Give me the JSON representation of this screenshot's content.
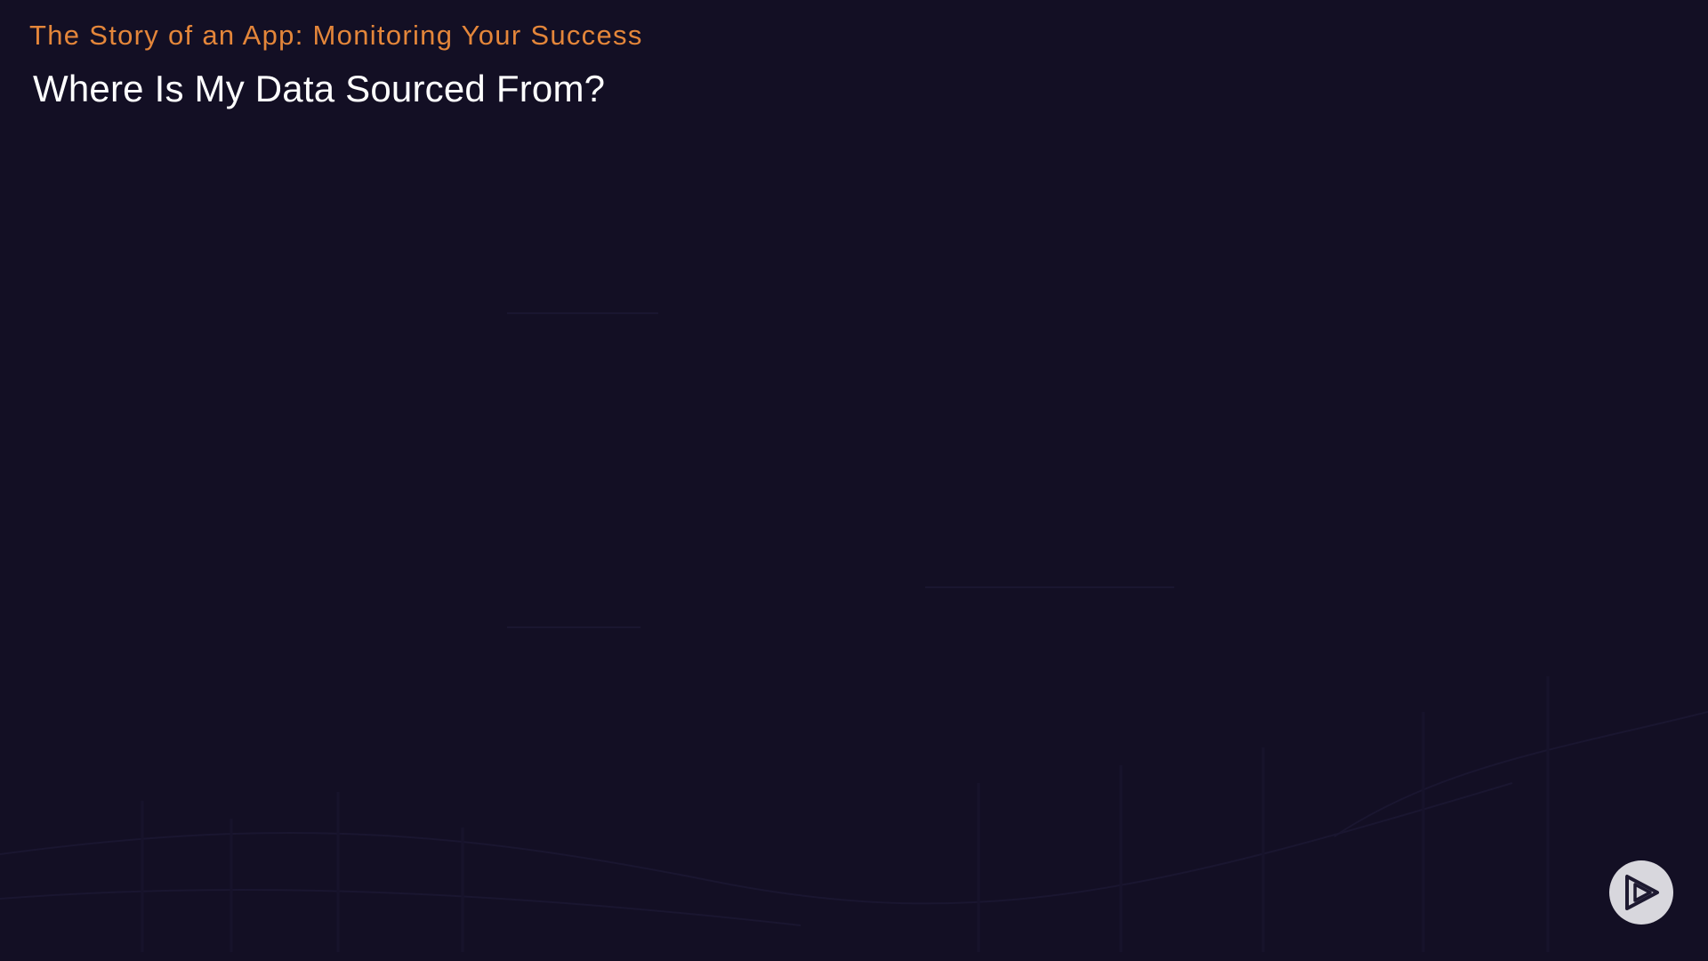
{
  "slide": {
    "course_title": "The Story of an App: Monitoring Your Success",
    "title": "Where Is My Data Sourced From?"
  },
  "brand": {
    "logo_icon": "play-triangle-logo-icon"
  },
  "colors": {
    "background": "#130f24",
    "course_title": "#e4863a",
    "title": "#ffffff",
    "logo_fill": "#d8d7dd",
    "logo_mark": "#1d1930"
  }
}
